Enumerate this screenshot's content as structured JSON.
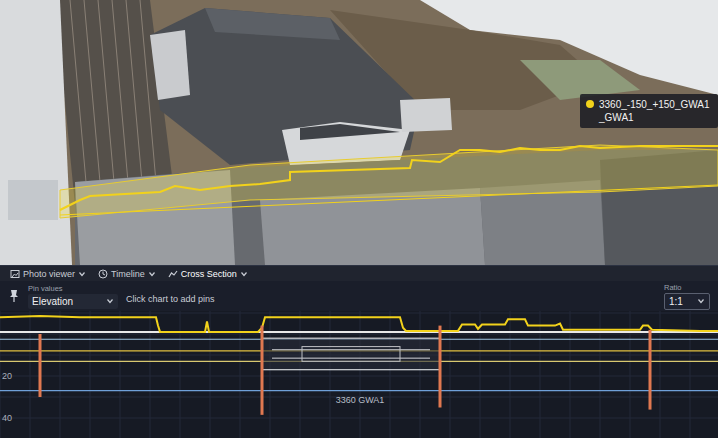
{
  "viewport": {
    "tooltip": {
      "lines": [
        "3360_-150_+150_GWA1",
        "_GWA1"
      ],
      "color": "#f2d21b"
    }
  },
  "panel_tabs": [
    {
      "label": "Photo viewer",
      "selected": false
    },
    {
      "label": "Timeline",
      "selected": false
    },
    {
      "label": "Cross Section",
      "selected": true
    }
  ],
  "toolbar": {
    "pin_values_label": "Pin values",
    "pin_values": "Elevation",
    "hint": "Click chart to add pins",
    "ratio_label": "Ratio",
    "ratio": "1:1"
  },
  "chart": {
    "y_ticks": [
      {
        "label": "20",
        "value": 20
      },
      {
        "label": "40",
        "value": 40
      }
    ],
    "section_label": "3360 GWA1",
    "profile": {
      "color": "#f2d21b",
      "x": [
        0,
        40,
        80,
        120,
        156,
        158,
        160,
        200,
        205,
        207,
        209,
        212,
        258,
        262,
        265,
        300,
        350,
        400,
        403,
        406,
        440,
        458,
        462,
        475,
        478,
        482,
        500,
        505,
        508,
        512,
        525,
        528,
        532,
        555,
        560,
        563,
        570,
        600,
        640,
        643,
        648,
        652,
        700,
        718
      ],
      "y": [
        -8,
        -8.5,
        -8,
        -8,
        -8,
        -4,
        -1,
        -1,
        -1,
        -6,
        -1,
        -1,
        -1,
        -3,
        -8,
        -8,
        -8,
        -8,
        -3,
        -1.5,
        -1.5,
        -1.5,
        -4.5,
        -4.5,
        -2.5,
        -4.5,
        -4.5,
        -4.5,
        -7,
        -7,
        -7,
        -4,
        -4,
        -4,
        -5,
        -2,
        -2,
        -2,
        -2,
        -4,
        -4,
        -2,
        -1.5,
        -1.5
      ]
    },
    "layers": [
      {
        "depth": -1,
        "color": "#e8e8e8"
      },
      {
        "depth": 2.5,
        "color": "#9fc4e0"
      },
      {
        "depth": 8,
        "color": "#e0c040"
      },
      {
        "depth": 13,
        "color": "#d8c870"
      },
      {
        "depth": 27,
        "color": "#6fa0d8"
      }
    ],
    "boreholes": [
      {
        "x": 40,
        "top": 0,
        "bottom": 30,
        "color": "#e07850"
      },
      {
        "x": 262,
        "top": -4,
        "bottom": 38.5,
        "color": "#e07850"
      },
      {
        "x": 440,
        "top": -4,
        "bottom": 35,
        "color": "#e07850"
      },
      {
        "x": 650,
        "top": -2,
        "bottom": 36,
        "color": "#e07850"
      }
    ],
    "structure": {
      "x0": 262,
      "x1": 440,
      "top": 2,
      "bottom": 17
    }
  }
}
